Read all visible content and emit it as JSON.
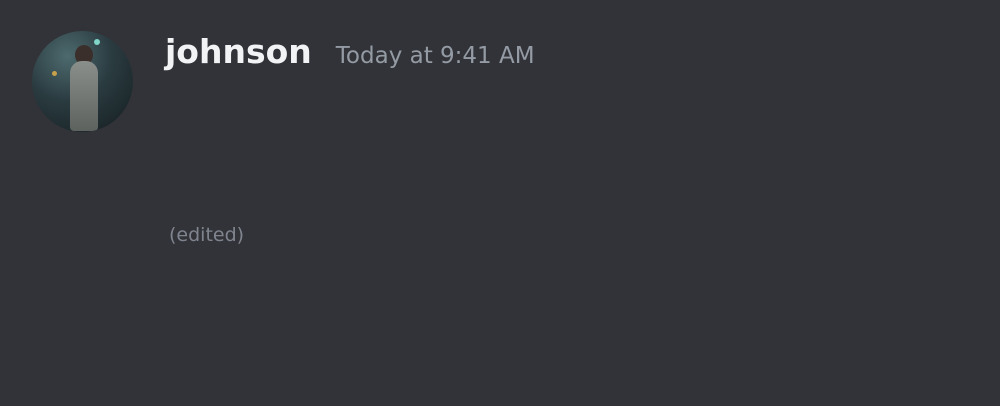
{
  "message": {
    "username": "johnson",
    "timestamp": "Today at 9:41 AM",
    "lines": [
      {
        "text": ""
      },
      {
        "text": ""
      },
      {
        "text": "",
        "edited_label": "(edited)"
      },
      {
        "text": ""
      }
    ]
  }
}
